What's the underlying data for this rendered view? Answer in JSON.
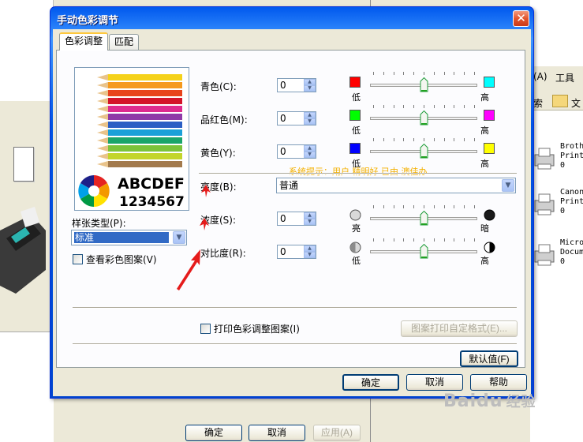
{
  "dialog": {
    "title": "手动色彩调节",
    "close_label": "✕",
    "tabs": [
      {
        "label": "色彩调整"
      },
      {
        "label": "匹配"
      }
    ],
    "preview": {
      "letters": "ABCDEF",
      "numbers": "1234567"
    },
    "paper_type": {
      "label": "样张类型(P):",
      "value": "标准"
    },
    "view_color_pattern": {
      "label": "查看彩色图案(V)",
      "checked": false
    },
    "sliders": [
      {
        "label": "青色(C):",
        "value": "0",
        "low_color": "#ff0000",
        "high_color": "#00ffff",
        "low_label": "低",
        "high_label": "高",
        "level": 0
      },
      {
        "label": "品红色(M):",
        "value": "0",
        "low_color": "#00ff00",
        "high_color": "#ff00ff",
        "low_label": "低",
        "high_label": "高",
        "level": 0
      },
      {
        "label": "黄色(Y):",
        "value": "0",
        "low_color": "#0000ff",
        "high_color": "#ffff00",
        "low_label": "低",
        "high_label": "高",
        "level": 0
      }
    ],
    "brightness": {
      "label": "亮度(B):",
      "value": "普通"
    },
    "sliders2": [
      {
        "label": "浓度(S):",
        "value": "0",
        "low_label": "亮",
        "high_label": "暗",
        "level": 0
      },
      {
        "label": "对比度(R):",
        "value": "0",
        "low_label": "低",
        "high_label": "高",
        "level": 0
      }
    ],
    "watermark": "系统提示：用户 精明好 已由 澳佳办",
    "print_pattern": {
      "label": "打印色彩调整图案(I)",
      "checked": false
    },
    "pattern_format_button": "图案打印自定格式(E)...",
    "default_button": "默认值(F)",
    "ok_button": "确定",
    "cancel_button": "取消",
    "help_button": "帮助"
  },
  "background": {
    "toolbar_items": [
      "(A)",
      "工具",
      "索",
      "文"
    ],
    "printers": [
      {
        "line1": "Broth",
        "line2": "Print",
        "line3": "0"
      },
      {
        "line1": "Canon",
        "line2": "Print",
        "line3": "0"
      },
      {
        "line1": "Micros",
        "line2": "Docume",
        "line3": "0"
      }
    ],
    "bottom_buttons": {
      "ok": "确定",
      "cancel": "取消",
      "apply": "应用(A)"
    },
    "watermark_brand": "Baidu",
    "watermark_brand_cn": "经验"
  }
}
